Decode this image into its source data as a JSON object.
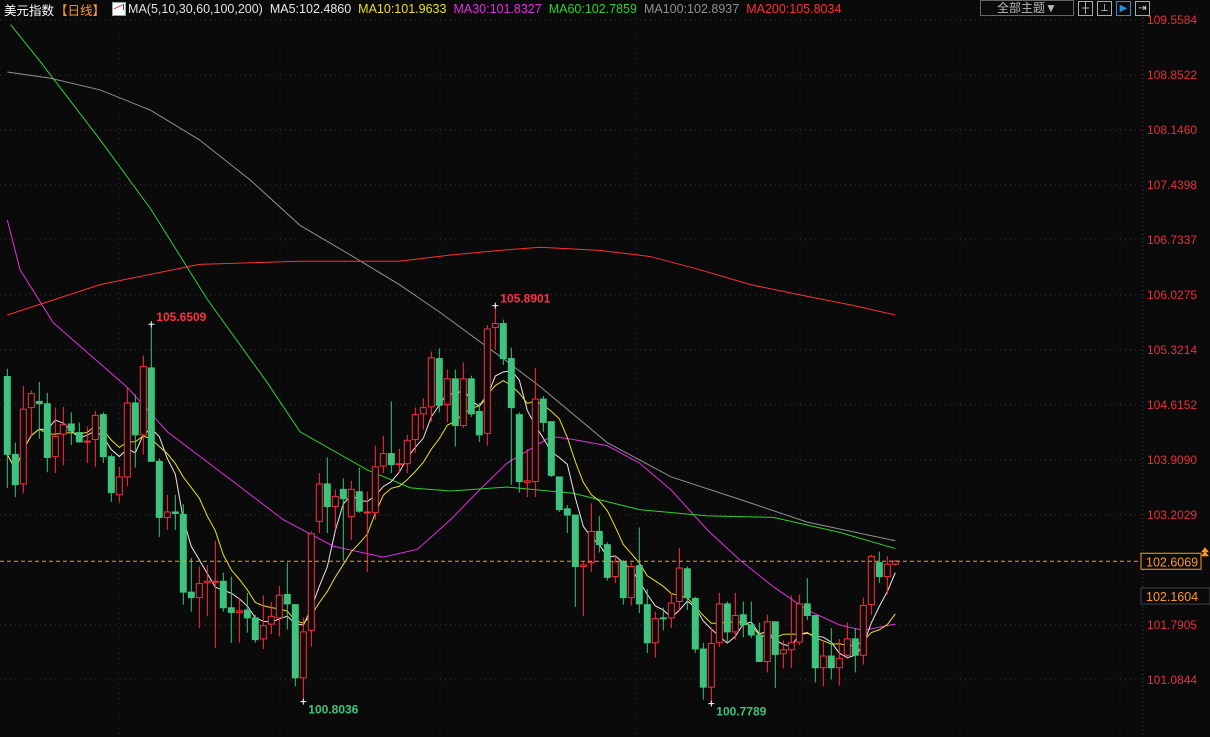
{
  "header": {
    "symbol": "美元指数",
    "period": "【日线】",
    "indicator": "MA(5,10,30,60,100,200)",
    "ma5": "MA5:102.4860",
    "ma10": "MA10:101.9633",
    "ma30": "MA30:101.8327",
    "ma60": "MA60:102.7859",
    "ma100": "MA100:102.8937",
    "ma200": "MA200:105.8034"
  },
  "toolbar": {
    "theme_label": "全部主题▼",
    "icons": [
      "crosshair-icon",
      "interval-icon",
      "play-cursor-icon",
      "exit-icon"
    ]
  },
  "colors": {
    "up": "#ff2d3c",
    "down": "#3cc47c",
    "ma5": "#e8e8e8",
    "ma10": "#e8e020",
    "ma30": "#e030e0",
    "ma60": "#30d030",
    "ma100": "#909090",
    "ma200": "#ff3030",
    "current": "#ff9a20"
  },
  "chart_data": {
    "type": "candlestick",
    "title": "美元指数 日线",
    "ylim": [
      100.35,
      109.815
    ],
    "y_ticks": [
      "109.5584",
      "108.8522",
      "108.1460",
      "107.4398",
      "106.7337",
      "106.0275",
      "105.3214",
      "104.6152",
      "103.9090",
      "103.2029",
      "101.7905",
      "101.0844"
    ],
    "current_price": "102.6069",
    "marker_price": "102.1604",
    "annotations": [
      {
        "index": 18,
        "label": "105.6509",
        "price": 105.6509,
        "kind": "high"
      },
      {
        "index": 61,
        "label": "105.8901",
        "price": 105.8901,
        "kind": "high"
      },
      {
        "index": 37,
        "label": "100.8036",
        "price": 100.8036,
        "kind": "low"
      },
      {
        "index": 88,
        "label": "100.7789",
        "price": 100.7789,
        "kind": "low"
      }
    ],
    "ohlc": [
      [
        104.98,
        105.08,
        103.55,
        103.98
      ],
      [
        103.98,
        104.13,
        103.43,
        103.59
      ],
      [
        103.6,
        104.86,
        103.48,
        104.56
      ],
      [
        104.58,
        104.8,
        104.2,
        104.76
      ],
      [
        104.66,
        104.91,
        104.18,
        104.63
      ],
      [
        104.63,
        104.77,
        103.75,
        103.94
      ],
      [
        103.95,
        104.58,
        103.74,
        104.21
      ],
      [
        104.24,
        104.59,
        103.84,
        104.36
      ],
      [
        104.37,
        104.52,
        104.1,
        104.28
      ],
      [
        104.26,
        104.39,
        104.13,
        104.14
      ],
      [
        104.14,
        104.34,
        103.87,
        104.15
      ],
      [
        104.17,
        104.54,
        103.82,
        104.48
      ],
      [
        104.49,
        104.52,
        103.87,
        103.95
      ],
      [
        103.95,
        103.98,
        103.37,
        103.49
      ],
      [
        103.46,
        103.82,
        103.36,
        103.69
      ],
      [
        103.69,
        104.84,
        103.57,
        104.64
      ],
      [
        104.64,
        104.75,
        103.81,
        104.23
      ],
      [
        104.23,
        105.25,
        103.98,
        105.11
      ],
      [
        105.09,
        105.65,
        103.89,
        103.89
      ],
      [
        103.89,
        103.93,
        102.92,
        103.17
      ],
      [
        103.17,
        103.46,
        103.01,
        103.24
      ],
      [
        103.24,
        103.46,
        103.01,
        103.22
      ],
      [
        103.21,
        103.34,
        102.05,
        102.21
      ],
      [
        102.21,
        102.65,
        101.96,
        102.14
      ],
      [
        102.14,
        102.54,
        101.75,
        102.32
      ],
      [
        102.33,
        102.56,
        101.9,
        102.35
      ],
      [
        102.34,
        102.87,
        101.49,
        102.35
      ],
      [
        102.35,
        102.46,
        101.96,
        102.01
      ],
      [
        102.01,
        102.41,
        101.56,
        101.95
      ],
      [
        101.95,
        102.14,
        101.56,
        101.97
      ],
      [
        101.98,
        102.2,
        101.69,
        101.88
      ],
      [
        101.88,
        101.92,
        101.56,
        101.6
      ],
      [
        101.61,
        102.17,
        101.48,
        101.78
      ],
      [
        101.8,
        102.08,
        101.67,
        101.9
      ],
      [
        101.88,
        102.29,
        101.64,
        102.17
      ],
      [
        102.18,
        102.59,
        101.73,
        102.06
      ],
      [
        102.05,
        102.05,
        101.0,
        101.11
      ],
      [
        101.11,
        101.88,
        100.8,
        101.7
      ],
      [
        101.72,
        102.99,
        101.51,
        102.96
      ],
      [
        103.12,
        103.74,
        102.97,
        103.6
      ],
      [
        103.6,
        103.94,
        102.97,
        103.31
      ],
      [
        103.31,
        103.53,
        103.01,
        103.44
      ],
      [
        103.53,
        103.67,
        102.62,
        103.41
      ],
      [
        103.18,
        103.64,
        102.88,
        103.53
      ],
      [
        103.5,
        103.81,
        103.23,
        103.25
      ],
      [
        103.23,
        103.5,
        102.47,
        103.24
      ],
      [
        103.23,
        104.09,
        103.14,
        103.82
      ],
      [
        103.83,
        104.22,
        103.74,
        103.99
      ],
      [
        103.99,
        104.66,
        103.74,
        103.85
      ],
      [
        103.85,
        104.05,
        103.74,
        103.86
      ],
      [
        103.86,
        104.23,
        103.74,
        104.16
      ],
      [
        104.17,
        104.58,
        104.0,
        104.49
      ],
      [
        104.5,
        104.7,
        104.3,
        104.58
      ],
      [
        104.59,
        105.3,
        104.4,
        105.22
      ],
      [
        105.21,
        105.34,
        104.52,
        104.61
      ],
      [
        104.62,
        105.07,
        104.39,
        104.95
      ],
      [
        104.95,
        105.07,
        104.08,
        104.35
      ],
      [
        104.35,
        105.16,
        104.32,
        104.95
      ],
      [
        104.95,
        104.99,
        104.46,
        104.5
      ],
      [
        104.53,
        104.64,
        104.14,
        104.23
      ],
      [
        104.25,
        105.64,
        104.09,
        105.59
      ],
      [
        105.61,
        105.89,
        105.33,
        105.66
      ],
      [
        105.66,
        105.71,
        105.13,
        105.21
      ],
      [
        105.21,
        105.35,
        103.59,
        104.58
      ],
      [
        104.49,
        104.52,
        103.49,
        103.63
      ],
      [
        103.62,
        104.05,
        103.43,
        103.64
      ],
      [
        103.63,
        105.09,
        103.43,
        104.69
      ],
      [
        104.69,
        104.73,
        104.27,
        104.39
      ],
      [
        104.4,
        104.4,
        103.69,
        103.71
      ],
      [
        103.69,
        103.69,
        103.24,
        103.27
      ],
      [
        103.28,
        103.33,
        102.97,
        103.2
      ],
      [
        103.2,
        103.2,
        102.02,
        102.54
      ],
      [
        102.54,
        102.6,
        101.9,
        102.56
      ],
      [
        102.59,
        103.35,
        102.47,
        102.99
      ],
      [
        102.99,
        103.19,
        102.72,
        102.82
      ],
      [
        102.82,
        102.85,
        102.36,
        102.4
      ],
      [
        102.41,
        102.69,
        102.33,
        102.6
      ],
      [
        102.6,
        102.62,
        102.05,
        102.14
      ],
      [
        102.14,
        102.59,
        102.04,
        102.54
      ],
      [
        102.55,
        103.04,
        101.94,
        102.06
      ],
      [
        102.05,
        102.25,
        101.43,
        101.56
      ],
      [
        101.56,
        101.96,
        101.37,
        101.87
      ],
      [
        101.88,
        102.01,
        101.72,
        101.87
      ],
      [
        101.88,
        102.2,
        101.75,
        102.07
      ],
      [
        102.09,
        102.78,
        101.96,
        102.52
      ],
      [
        102.51,
        102.54,
        101.98,
        102.14
      ],
      [
        102.13,
        102.15,
        101.43,
        101.48
      ],
      [
        101.48,
        101.56,
        100.83,
        100.99
      ],
      [
        100.99,
        101.76,
        100.78,
        101.55
      ],
      [
        101.56,
        102.2,
        101.51,
        102.06
      ],
      [
        102.06,
        102.09,
        101.57,
        101.7
      ],
      [
        101.7,
        102.2,
        101.6,
        101.91
      ],
      [
        101.92,
        102.09,
        101.63,
        101.79
      ],
      [
        101.79,
        102.09,
        101.62,
        101.66
      ],
      [
        101.66,
        101.82,
        101.32,
        101.32
      ],
      [
        101.32,
        101.92,
        101.18,
        101.83
      ],
      [
        101.83,
        101.83,
        100.98,
        101.41
      ],
      [
        101.42,
        101.59,
        101.23,
        101.47
      ],
      [
        101.47,
        102.17,
        101.24,
        101.56
      ],
      [
        101.57,
        102.18,
        101.53,
        102.06
      ],
      [
        102.06,
        102.39,
        101.85,
        101.91
      ],
      [
        101.91,
        101.91,
        101.05,
        101.24
      ],
      [
        101.24,
        101.59,
        101.0,
        101.39
      ],
      [
        101.39,
        101.75,
        101.09,
        101.24
      ],
      [
        101.24,
        101.61,
        101.01,
        101.36
      ],
      [
        101.4,
        101.82,
        101.35,
        101.61
      ],
      [
        101.61,
        101.75,
        101.18,
        101.4
      ],
      [
        101.4,
        102.14,
        101.28,
        102.04
      ],
      [
        102.05,
        102.69,
        101.92,
        102.67
      ],
      [
        102.59,
        102.73,
        102.33,
        102.41
      ],
      [
        102.41,
        102.67,
        102.18,
        102.57
      ],
      [
        102.57,
        102.62,
        102.55,
        102.61
      ]
    ],
    "ma_series": [
      {
        "name": "MA30",
        "color_key": "ma30",
        "points": [
          [
            0,
            106.99
          ],
          [
            1.6,
            106.35
          ],
          [
            5.75,
            105.67
          ],
          [
            15,
            104.84
          ],
          [
            20,
            104.27
          ],
          [
            28.25,
            103.63
          ],
          [
            34.5,
            103.14
          ],
          [
            40.75,
            102.8
          ],
          [
            47,
            102.66
          ],
          [
            51.25,
            102.76
          ],
          [
            55.4,
            103.14
          ],
          [
            59,
            103.52
          ],
          [
            62.5,
            103.87
          ],
          [
            68,
            104.21
          ],
          [
            70.75,
            104.17
          ],
          [
            75,
            104.09
          ],
          [
            79,
            103.87
          ],
          [
            83,
            103.52
          ],
          [
            87.5,
            103.01
          ],
          [
            91.6,
            102.62
          ],
          [
            95.75,
            102.28
          ],
          [
            100,
            101.98
          ],
          [
            104,
            101.79
          ],
          [
            107,
            101.72
          ],
          [
            111,
            101.8
          ]
        ]
      },
      {
        "name": "MA60",
        "color_key": "ma60",
        "points": [
          [
            0.4,
            109.5
          ],
          [
            4,
            109.04
          ],
          [
            11.6,
            108.02
          ],
          [
            18,
            107.12
          ],
          [
            25,
            105.97
          ],
          [
            32.5,
            104.9
          ],
          [
            36.6,
            104.27
          ],
          [
            45,
            103.78
          ],
          [
            50.4,
            103.55
          ],
          [
            55.4,
            103.51
          ],
          [
            62.5,
            103.56
          ],
          [
            70.75,
            103.48
          ],
          [
            79,
            103.27
          ],
          [
            87.5,
            103.19
          ],
          [
            95.75,
            103.17
          ],
          [
            104,
            102.98
          ],
          [
            111,
            102.77
          ]
        ]
      },
      {
        "name": "MA100",
        "color_key": "ma100",
        "points": [
          [
            0,
            108.89
          ],
          [
            5.4,
            108.81
          ],
          [
            11.6,
            108.66
          ],
          [
            17.9,
            108.4
          ],
          [
            24,
            108.02
          ],
          [
            30.4,
            107.5
          ],
          [
            36.6,
            106.92
          ],
          [
            42.9,
            106.54
          ],
          [
            49,
            106.16
          ],
          [
            54,
            105.81
          ],
          [
            62.5,
            105.17
          ],
          [
            66.6,
            104.85
          ],
          [
            75,
            104.13
          ],
          [
            83,
            103.69
          ],
          [
            91.6,
            103.4
          ],
          [
            100,
            103.11
          ],
          [
            111,
            102.87
          ]
        ]
      },
      {
        "name": "MA200",
        "color_key": "ma200",
        "points": [
          [
            0,
            105.77
          ],
          [
            11.6,
            106.16
          ],
          [
            24,
            106.42
          ],
          [
            36.6,
            106.46
          ],
          [
            49,
            106.46
          ],
          [
            55.4,
            106.54
          ],
          [
            61.6,
            106.6
          ],
          [
            66.6,
            106.64
          ],
          [
            74,
            106.6
          ],
          [
            80.4,
            106.52
          ],
          [
            86.6,
            106.35
          ],
          [
            92.9,
            106.16
          ],
          [
            99,
            106.03
          ],
          [
            105.4,
            105.9
          ],
          [
            111,
            105.77
          ]
        ]
      }
    ],
    "computed_ma": [
      {
        "name": "MA5",
        "period": 5,
        "color_key": "ma5"
      },
      {
        "name": "MA10",
        "period": 10,
        "color_key": "ma10"
      }
    ]
  }
}
